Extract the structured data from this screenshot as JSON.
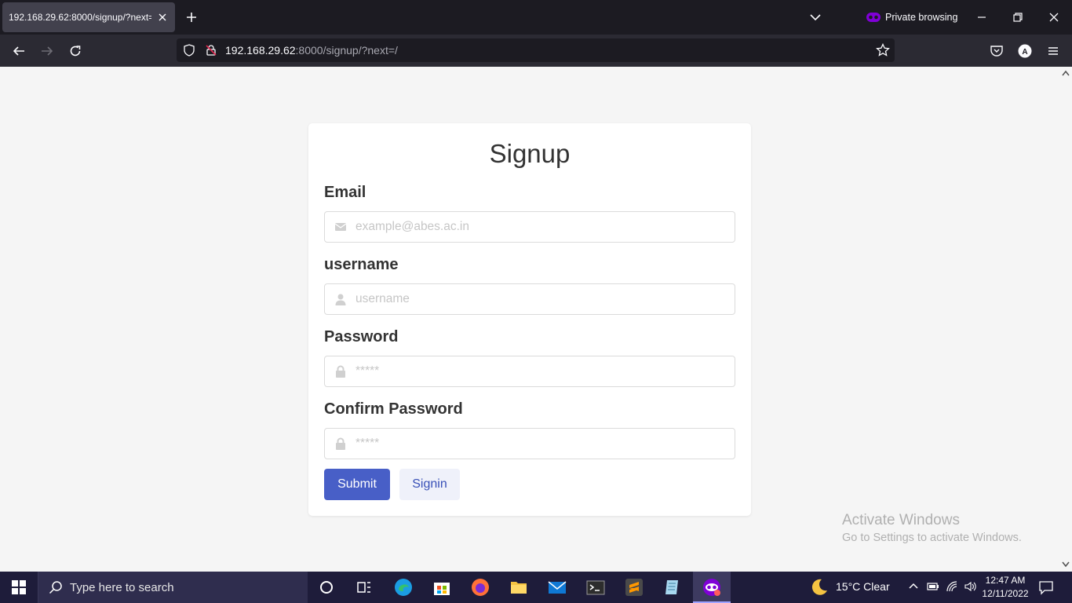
{
  "browser": {
    "tab_title": "192.168.29.62:8000/signup/?next=/",
    "private_label": "Private browsing",
    "url_host": "192.168.29.62",
    "url_rest": ":8000/signup/?next=/"
  },
  "form": {
    "title": "Signup",
    "email_label": "Email",
    "email_placeholder": "example@abes.ac.in",
    "username_label": "username",
    "username_placeholder": "username",
    "password_label": "Password",
    "password_placeholder": "*****",
    "confirm_label": "Confirm Password",
    "confirm_placeholder": "*****",
    "submit_label": "Submit",
    "signin_label": "Signin"
  },
  "watermark": {
    "line1": "Activate Windows",
    "line2": "Go to Settings to activate Windows."
  },
  "taskbar": {
    "search_placeholder": "Type here to search",
    "weather": "15°C  Clear",
    "time": "12:47 AM",
    "date": "12/11/2022",
    "apps": [
      "cortana-icon",
      "task-view-icon",
      "edge-icon",
      "store-icon",
      "firefox-icon",
      "file-explorer-icon",
      "mail-icon",
      "terminal-icon",
      "sublime-text-icon",
      "notepad-icon",
      "firefox-private-icon"
    ]
  },
  "colors": {
    "primary": "#485fc7",
    "primary_light": "#eff1fa",
    "browser_dark": "#1c1b22",
    "private_purple": "#8000d7"
  }
}
